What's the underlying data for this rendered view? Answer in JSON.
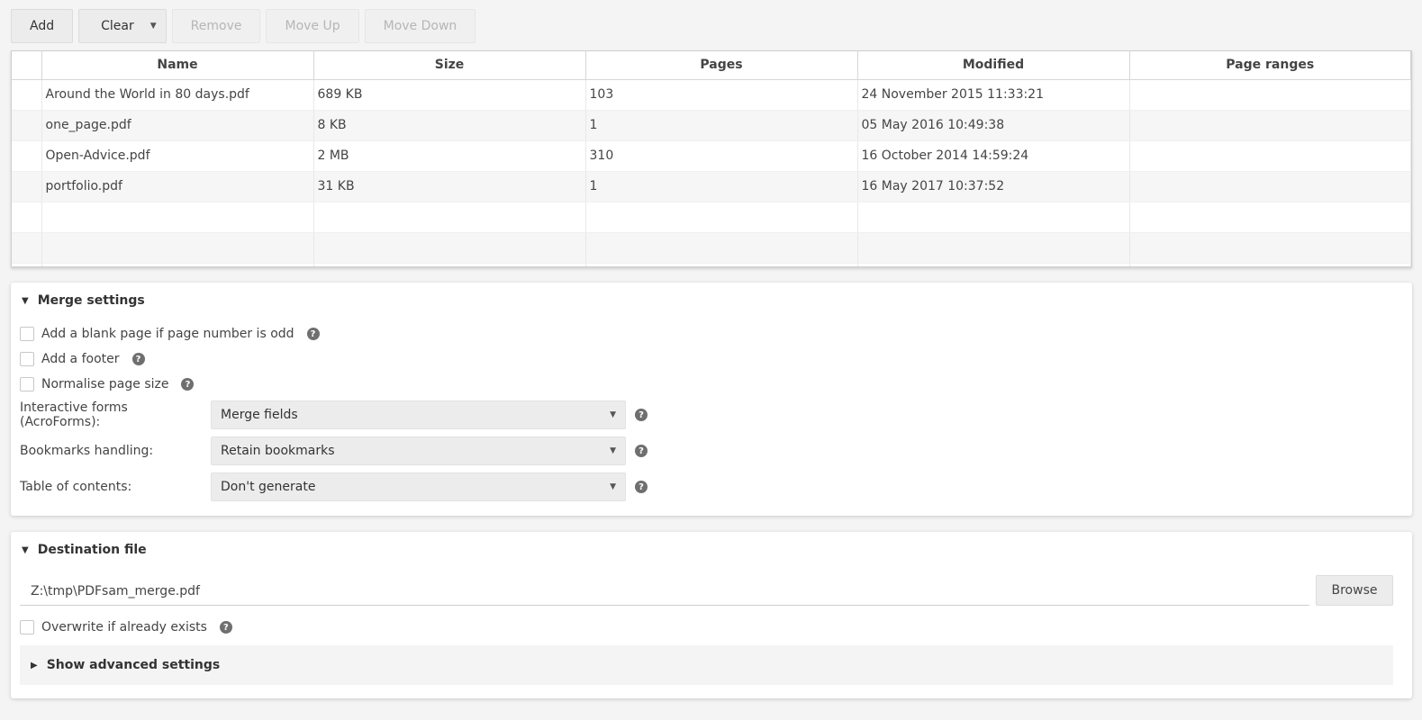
{
  "toolbar": {
    "add": "Add",
    "clear": "Clear",
    "remove": "Remove",
    "move_up": "Move Up",
    "move_down": "Move Down",
    "caret_icon": "▼"
  },
  "table": {
    "columns": [
      "",
      "Name",
      "Size",
      "Pages",
      "Modified",
      "Page ranges"
    ],
    "rows": [
      {
        "name": "Around the World in 80 days.pdf",
        "size": "689 KB",
        "pages": "103",
        "modified": "24 November 2015 11:33:21",
        "ranges": ""
      },
      {
        "name": "one_page.pdf",
        "size": "8 KB",
        "pages": "1",
        "modified": "05 May 2016 10:49:38",
        "ranges": ""
      },
      {
        "name": "Open-Advice.pdf",
        "size": "2 MB",
        "pages": "310",
        "modified": "16 October 2014 14:59:24",
        "ranges": ""
      },
      {
        "name": "portfolio.pdf",
        "size": "31 KB",
        "pages": "1",
        "modified": "16 May 2017 10:37:52",
        "ranges": ""
      }
    ]
  },
  "merge_settings": {
    "title": "Merge settings",
    "expanded_icon": "▼",
    "help_icon": "?",
    "checkboxes": [
      {
        "label": "Add a blank page if page number is odd",
        "checked": false
      },
      {
        "label": "Add a footer",
        "checked": false
      },
      {
        "label": "Normalise page size",
        "checked": false
      }
    ],
    "selects": [
      {
        "label": "Interactive forms (AcroForms):",
        "value": "Merge fields"
      },
      {
        "label": "Bookmarks handling:",
        "value": "Retain bookmarks"
      },
      {
        "label": "Table of contents:",
        "value": "Don't generate"
      }
    ],
    "dropdown_icon": "▼"
  },
  "destination": {
    "title": "Destination file",
    "path": "Z:\\tmp\\PDFsam_merge.pdf",
    "browse": "Browse",
    "overwrite_label": "Overwrite if already exists",
    "overwrite_checked": false,
    "advanced_label": "Show advanced settings",
    "collapsed_icon": "▶"
  }
}
